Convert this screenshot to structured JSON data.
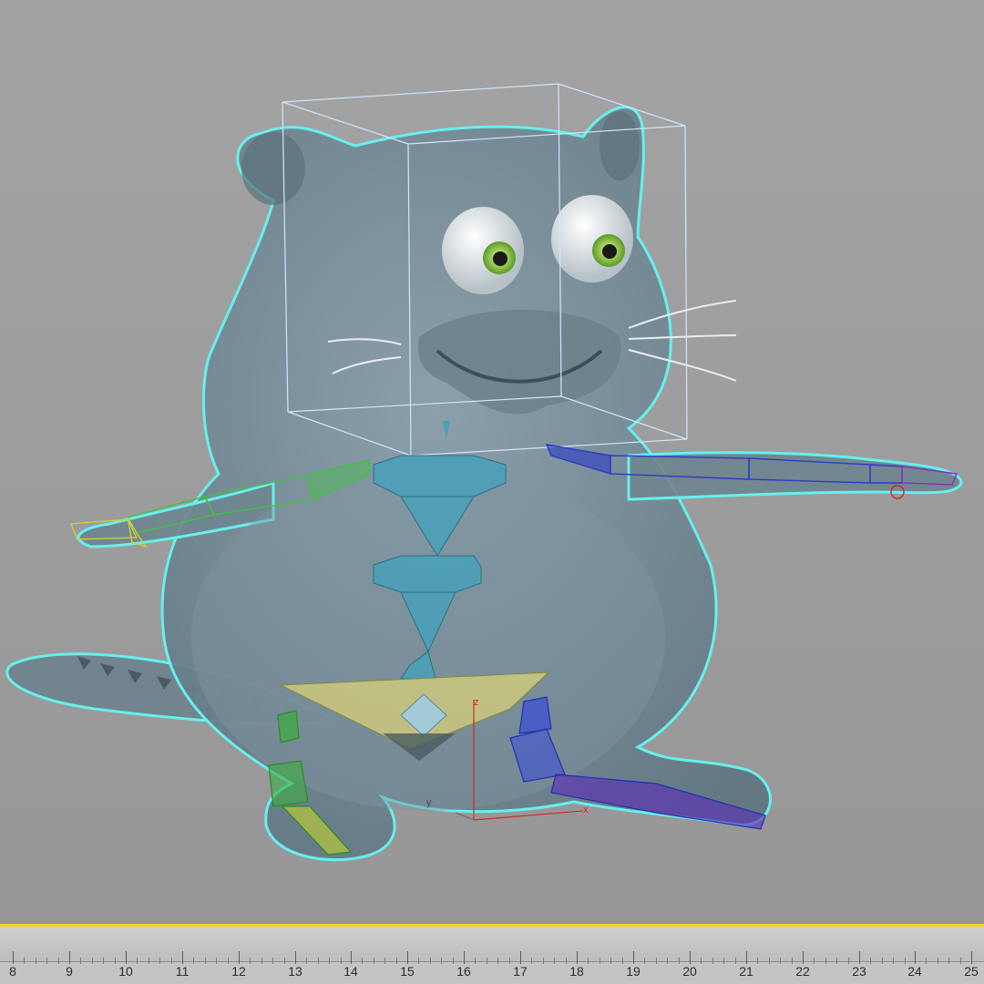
{
  "viewport": {
    "name": "3d viewport",
    "selection_color": "#66f0ee",
    "axis_labels": {
      "x": "x",
      "y": "y",
      "z": "z"
    }
  },
  "timeline": {
    "slider_color": "#ffd21a",
    "frame_labels": [
      "8",
      "9",
      "10",
      "11",
      "12",
      "13",
      "14",
      "15",
      "16",
      "17",
      "18",
      "19",
      "20",
      "21",
      "22",
      "23",
      "24",
      "25"
    ]
  }
}
